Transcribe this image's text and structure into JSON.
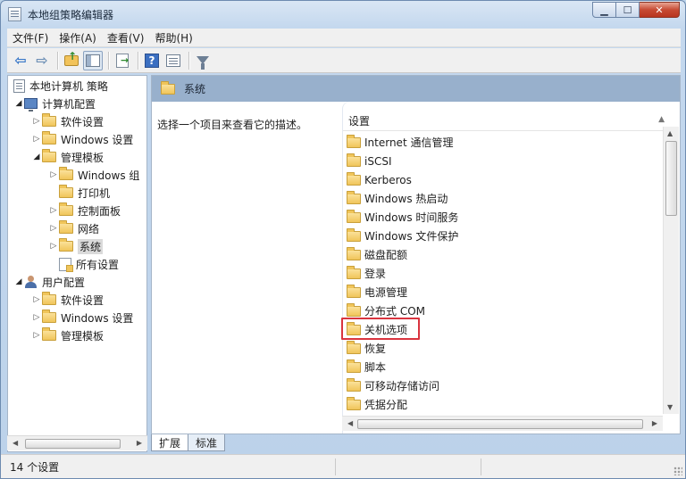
{
  "window": {
    "title": "本地组策略编辑器"
  },
  "menu": {
    "items": [
      "文件(F)",
      "操作(A)",
      "查看(V)",
      "帮助(H)"
    ]
  },
  "toolbar": {
    "icons": [
      "back-icon",
      "forward-icon",
      "up-folder-icon",
      "show-hide-tree-icon",
      "export-list-icon",
      "help-icon",
      "properties-icon",
      "filter-icon"
    ]
  },
  "tree": {
    "root": "本地计算机 策略",
    "computer_config": "计算机配置",
    "cc_software": "软件设置",
    "cc_windows": "Windows 设置",
    "cc_admin": "管理模板",
    "at_windows": "Windows 组",
    "at_printer": "打印机",
    "at_control_panel": "控制面板",
    "at_network": "网络",
    "at_system": "系统",
    "at_all": "所有设置",
    "user_config": "用户配置",
    "uc_software": "软件设置",
    "uc_windows": "Windows 设置",
    "uc_admin": "管理模板"
  },
  "right": {
    "header_title": "系统",
    "description": "选择一个项目来查看它的描述。",
    "column": "设置",
    "items": [
      "Internet 通信管理",
      "iSCSI",
      "Kerberos",
      "Windows 热启动",
      "Windows 时间服务",
      "Windows 文件保护",
      "磁盘配额",
      "登录",
      "电源管理",
      "分布式 COM",
      "关机选项",
      "恢复",
      "脚本",
      "可移动存储访问",
      "凭据分配"
    ],
    "highlighted_item": "关机选项"
  },
  "tabs": [
    "扩展",
    "标准"
  ],
  "status": {
    "text": "14 个设置"
  },
  "colors": {
    "highlight_border": "#d9343f",
    "header_band": "#98b0cc"
  }
}
